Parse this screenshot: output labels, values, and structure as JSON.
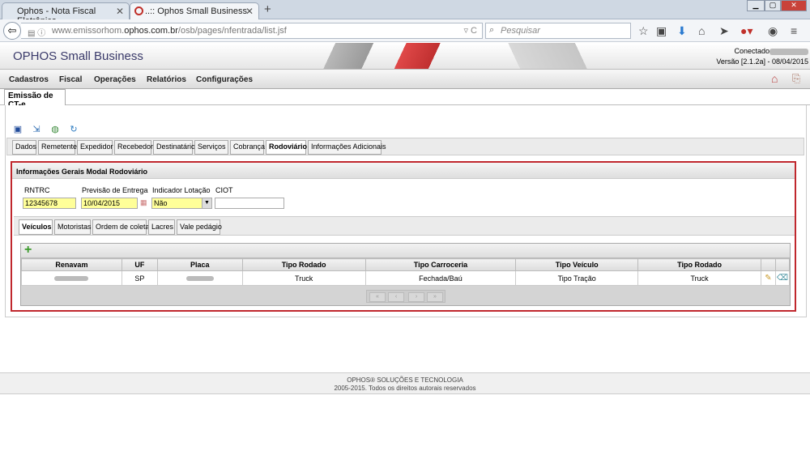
{
  "browser": {
    "tabs": [
      {
        "title": "Ophos - Nota Fiscal Eletrônica"
      },
      {
        "title": "..:: Ophos Small Business"
      }
    ],
    "url_prefix": "www.emissorhom.",
    "url_domain": "ophos.com.br",
    "url_path": "/osb/pages/nfentrada/list.jsf",
    "search_placeholder": "Pesquisar"
  },
  "header": {
    "app_title": "OPHOS Small Business",
    "connected_label": "Conectado",
    "version": "Versão [2.1.2a] - 08/04/2015"
  },
  "menu": [
    "Cadastros",
    "Fiscal",
    "Operações",
    "Relatórios",
    "Configurações"
  ],
  "page_tab": "Emissão de CT-e",
  "main_tabs": [
    "Dados",
    "Remetente",
    "Expedidor",
    "Recebedor",
    "Destinatário",
    "Serviços",
    "Cobrança",
    "Rodoviário",
    "Informações Adicionais"
  ],
  "section": {
    "title": "Informações Gerais Modal Rodoviário",
    "rntrc_label": "RNTRC",
    "rntrc_value": "12345678",
    "previsao_label": "Previsão de Entrega",
    "previsao_value": "10/04/2015",
    "lotacao_label": "Indicador Lotação",
    "lotacao_value": "Não",
    "ciot_label": "CIOT",
    "ciot_value": ""
  },
  "sub_tabs": [
    "Veículos",
    "Motoristas",
    "Ordem de coleta",
    "Lacres",
    "Vale pedágio"
  ],
  "grid": {
    "columns": [
      "Renavam",
      "UF",
      "Placa",
      "Tipo Rodado",
      "Tipo Carroceria",
      "Tipo Veículo",
      "Tipo Rodado"
    ],
    "row": {
      "uf": "SP",
      "tipo_rodado": "Truck",
      "tipo_carroceria": "Fechada/Baú",
      "tipo_veiculo": "Tipo Tração",
      "tipo_rodado2": "Truck"
    },
    "pager": [
      "«",
      "‹",
      "›",
      "»"
    ]
  },
  "footer": {
    "line1": "OPHOS® SOLUÇÕES E TECNOLOGIA",
    "line2": "2005-2015. Todos os direitos autorais reservados"
  }
}
